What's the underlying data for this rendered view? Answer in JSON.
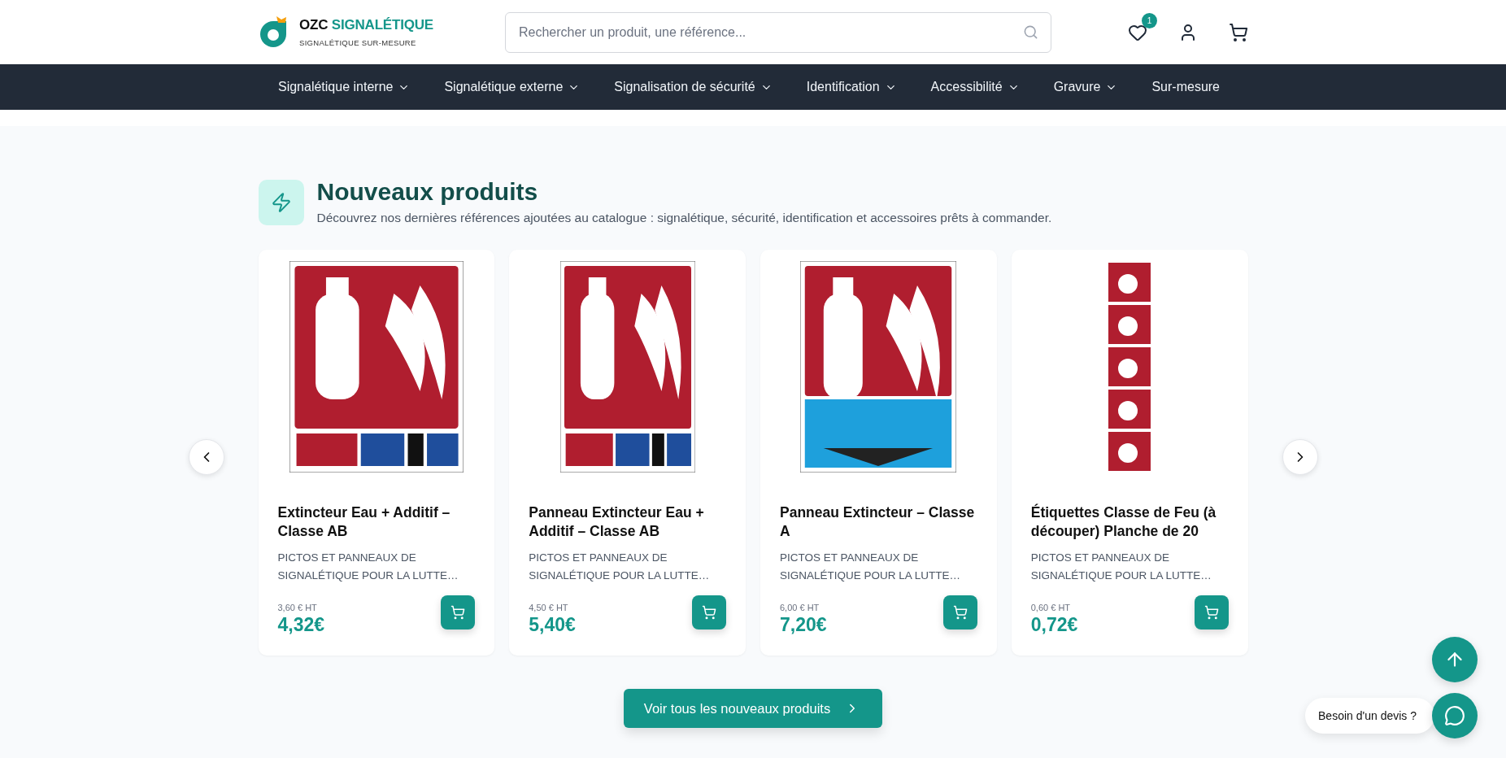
{
  "brand": {
    "name_part_1": "OZC",
    "name_part_2": "SIGNALÉTIQUE",
    "tagline": "SIGNALÉTIQUE SUR-MESURE"
  },
  "search": {
    "placeholder": "Rechercher un produit, une référence..."
  },
  "wishlist": {
    "count": "1"
  },
  "nav": [
    {
      "label": "Signalétique interne",
      "dropdown": true
    },
    {
      "label": "Signalétique externe",
      "dropdown": true
    },
    {
      "label": "Signalisation de sécurité",
      "dropdown": true
    },
    {
      "label": "Identification",
      "dropdown": true
    },
    {
      "label": "Accessibilité",
      "dropdown": true
    },
    {
      "label": "Gravure",
      "dropdown": true
    },
    {
      "label": "Sur-mesure",
      "dropdown": false
    }
  ],
  "section": {
    "title": "Nouveaux produits",
    "subtitle": "Découvrez nos dernières références ajoutées au catalogue : signalétique, sécurité, identification et accessoires prêts à commander."
  },
  "products": [
    {
      "title": "Extincteur Eau + Additif – Classe AB",
      "category": "PICTOS ET PANNEAUX DE SIGNALÉTIQUE POUR LA LUTTE…",
      "price_ht": "3,60 € HT",
      "price": "4,32€",
      "kind": "picture"
    },
    {
      "title": "Panneau Extincteur Eau + Additif – Classe AB",
      "category": "PICTOS ET PANNEAUX DE SIGNALÉTIQUE POUR LA LUTTE…",
      "price_ht": "4,50 € HT",
      "price": "5,40€",
      "kind": "picture"
    },
    {
      "title": "Panneau Extincteur – Classe A",
      "category": "PICTOS ET PANNEAUX DE SIGNALÉTIQUE POUR LA LUTTE…",
      "price_ht": "6,00 € HT",
      "price": "7,20€",
      "kind": "picture"
    },
    {
      "title": "Étiquettes Classe de Feu (à découper) Planche de 20",
      "category": "PICTOS ET PANNEAUX DE SIGNALÉTIQUE POUR LA LUTTE…",
      "price_ht": "0,60 € HT",
      "price": "0,72€",
      "kind": "picture"
    }
  ],
  "view_all": {
    "label": "Voir tous les nouveaux produits"
  },
  "quote_bubble": {
    "label": "Besoin d'un devis ?"
  }
}
